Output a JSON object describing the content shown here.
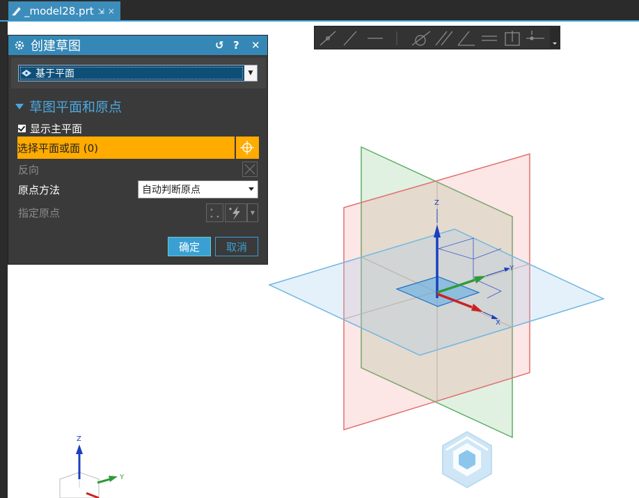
{
  "tab": {
    "filename": "_model28.prt",
    "pin_glyph": "⇲",
    "close_glyph": "×"
  },
  "dialog": {
    "title": "创建草图",
    "controls": {
      "reset": "↺",
      "help": "?",
      "close": "✕"
    },
    "type_value": "基于平面",
    "section_title": "草图平面和原点",
    "show_main_plane_label": "显示主平面",
    "show_main_plane_checked": true,
    "select_plane_prompt": "选择平面或面 (0)",
    "reverse_label": "反向",
    "origin_method_label": "原点方法",
    "origin_method_value": "自动判断原点",
    "specify_origin_label": "指定原点",
    "ok_label": "确定",
    "cancel_label": "取消"
  },
  "viewport": {
    "axes": {
      "z": "Z",
      "y": "Y",
      "x": "X"
    },
    "triad": {
      "z": "Z",
      "y": "Y"
    }
  },
  "colors": {
    "accent": "#3588b6",
    "highlight": "#ffab00",
    "plane_xy": "#6fb6e0",
    "plane_yz": "#e07070",
    "plane_xz": "#5aae62"
  },
  "toolbar_icons": [
    "line-icon",
    "line-icon",
    "line-icon",
    "arc-icon",
    "parallel-icon",
    "perpendicular-icon",
    "horizontal-icon",
    "midpoint-icon",
    "point-on-curve-icon",
    "more-icon"
  ]
}
